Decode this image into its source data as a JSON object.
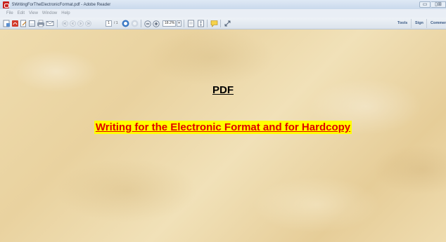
{
  "window": {
    "title": "5WritingForTheElectronicFormat.pdf - Adobe Reader",
    "min_symbol": "▭",
    "max_symbol": "▯⊞"
  },
  "menu": [
    "File",
    "Edit",
    "View",
    "Window",
    "Help"
  ],
  "toolbar": {
    "page_current": "1",
    "page_total": "/ 1",
    "zoom": "18.2%",
    "right_buttons": [
      "Tools",
      "Sign",
      "Comment"
    ]
  },
  "document": {
    "heading": "PDF",
    "subtitle": "Writing for the Electronic Format and for Hardcopy",
    "subtitle_color": "#e00000",
    "highlight_color": "#ffff00"
  }
}
